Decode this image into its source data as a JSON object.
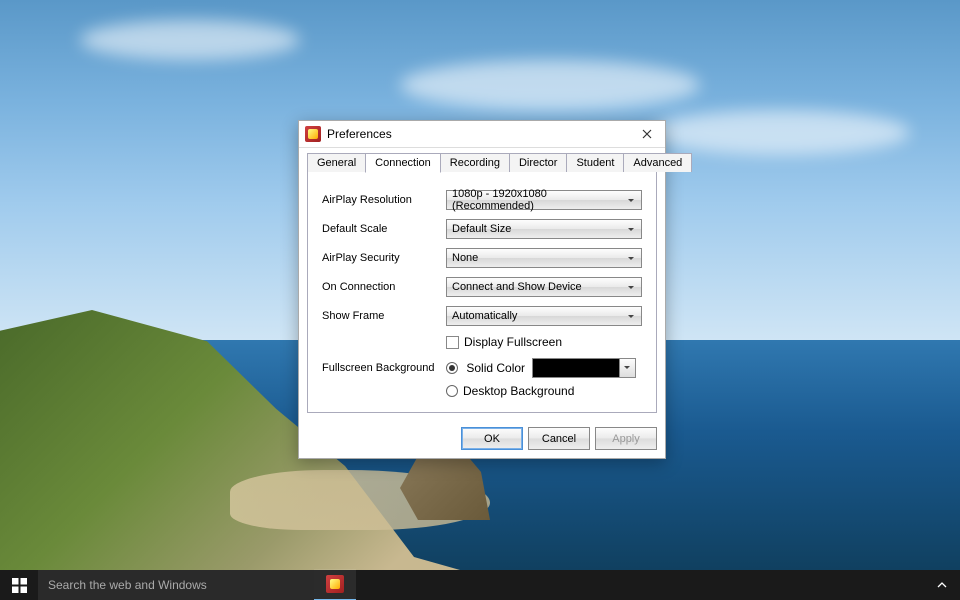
{
  "dialog": {
    "title": "Preferences",
    "tabs": [
      "General",
      "Connection",
      "Recording",
      "Director",
      "Student",
      "Advanced"
    ],
    "active_tab_index": 1,
    "connection": {
      "airplay_resolution": {
        "label": "AirPlay Resolution",
        "value": "1080p - 1920x1080 (Recommended)"
      },
      "default_scale": {
        "label": "Default Scale",
        "value": "Default Size"
      },
      "airplay_security": {
        "label": "AirPlay Security",
        "value": "None"
      },
      "on_connection": {
        "label": "On Connection",
        "value": "Connect and Show Device"
      },
      "show_frame": {
        "label": "Show Frame",
        "value": "Automatically"
      },
      "display_fullscreen": {
        "label": "Display Fullscreen",
        "checked": false
      },
      "fullscreen_background": {
        "label": "Fullscreen Background",
        "selected": "solid",
        "solid_label": "Solid Color",
        "solid_color": "#000000",
        "desktop_label": "Desktop Background"
      }
    },
    "buttons": {
      "ok": "OK",
      "cancel": "Cancel",
      "apply": "Apply"
    }
  },
  "taskbar": {
    "search_placeholder": "Search the web and Windows"
  }
}
